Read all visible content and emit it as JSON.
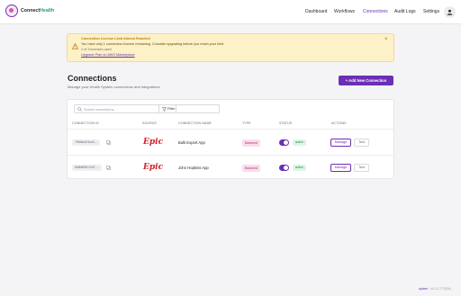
{
  "app": {
    "brand_part1": "Connect",
    "brand_part2": "Health"
  },
  "nav": {
    "items": [
      {
        "label": "Dashboard"
      },
      {
        "label": "Workflows"
      },
      {
        "label": "Connections",
        "active": true
      },
      {
        "label": "Audit Logs"
      },
      {
        "label": "Settings"
      }
    ],
    "user_icon": "user-icon"
  },
  "banner": {
    "title": "Connection License Limit Almost Reached",
    "message": "You have only 1 connection license remaining. Consider upgrading before you reach your limit.",
    "count": "2 of 3 licenses used",
    "link": "Upgrade Plan on AWS Marketplace",
    "close": "×"
  },
  "page": {
    "title": "Connections",
    "subtitle": "Manage your Health System connections and integrations",
    "add_button": "+ Add New Connection"
  },
  "toolbar": {
    "search_placeholder": "Search connections...",
    "filter_label": "Filter"
  },
  "table": {
    "columns": [
      "Connection ID",
      "Source",
      "Connection Name",
      "Type",
      "Status",
      "Actions"
    ],
    "rows": [
      {
        "id": "7f6b8c4f-9ce3-...",
        "source": "Epic",
        "name": "Bulk Export App",
        "type": "Backend",
        "status": "active",
        "manage": "Manage",
        "test": "Test"
      },
      {
        "id": "8d8b8f98-22d7-...",
        "source": "Epic",
        "name": "John Hopkins App",
        "type": "Backend",
        "status": "active",
        "manage": "Manage",
        "test": "Test"
      }
    ]
  },
  "footer": {
    "system": "system",
    "version": "v.0.1.0-777(Eth)"
  },
  "colors": {
    "accent": "#6b2fb3",
    "epic": "#d4202c",
    "banner_bg": "#fdf1c7",
    "status_active": "#1e8a4c"
  }
}
